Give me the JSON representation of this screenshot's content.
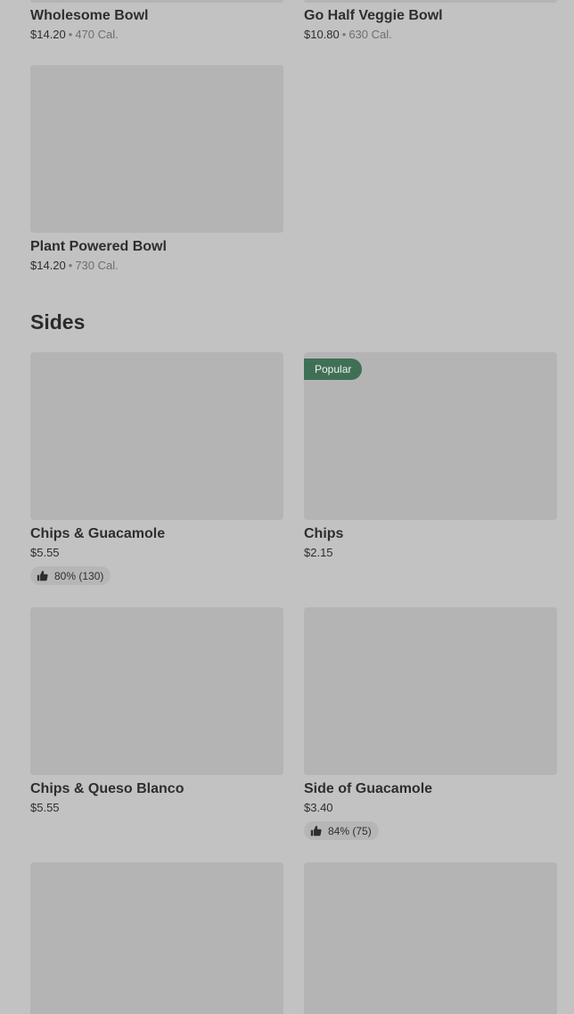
{
  "bowls": [
    {
      "name": "Wholesome Bowl",
      "price": "$14.20",
      "calories": "470 Cal."
    },
    {
      "name": "Go Half Veggie Bowl",
      "price": "$10.80",
      "calories": "630 Cal."
    },
    {
      "name": "Plant Powered Bowl",
      "price": "$14.20",
      "calories": "730 Cal."
    }
  ],
  "separator": "•",
  "sides": {
    "title": "Sides",
    "items": [
      {
        "name": "Chips & Guacamole",
        "price": "$5.55",
        "rating": "80% (130)"
      },
      {
        "name": "Chips",
        "price": "$2.15",
        "badge": "Popular"
      },
      {
        "name": "Chips & Queso Blanco",
        "price": "$5.55"
      },
      {
        "name": "Side of Guacamole",
        "price": "$3.40",
        "rating": "84% (75)"
      }
    ]
  },
  "icons": {
    "rating": "thumbs-up-icon"
  },
  "colors": {
    "badge": "#3f7056",
    "background": "#c2c2c2",
    "placeholder": "#b4b4b4"
  }
}
